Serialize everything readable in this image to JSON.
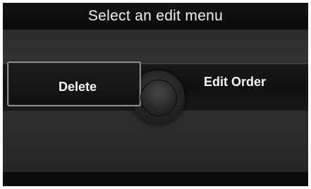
{
  "header": {
    "title": "Select an edit menu"
  },
  "menu": {
    "delete_label": "Delete",
    "edit_order_label": "Edit Order"
  },
  "colors": {
    "background": "#2a2a2a",
    "title_bar": "#0f0f0f",
    "text": "#f5f5f5",
    "highlight_border": "#8c8c8c"
  },
  "icons": {
    "knob": "interface-dial-icon"
  }
}
